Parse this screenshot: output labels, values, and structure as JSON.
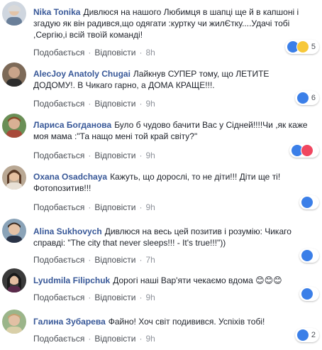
{
  "actions": {
    "like": "Подобається",
    "reply": "Відповісти",
    "sep": "·"
  },
  "colors": {
    "author": "#385898",
    "like": "#3b7fe8",
    "haha": "#f7c83a",
    "love": "#f0465f"
  },
  "comments": [
    {
      "author": "Nika Tonika",
      "text": "Дивлюся на нашого Любимця в шапці ще й в капшоні і згадую як він радився,що одягати :куртку чи жилЄтку....Удачі тобі ,Сергію,і всій твоїй команді!",
      "time": "8h",
      "reactions": [
        "like",
        "haha"
      ],
      "count": "5"
    },
    {
      "author": "AlecJoy Anatoly Chugai",
      "text": "Лайкнув СУПЕР тому, що ЛЕТИТЕ ДОДОМУ!. В Чикаго гарно, а ДОМА КРАЩЕ!!!.",
      "time": "9h",
      "reactions": [
        "like"
      ],
      "count": "6"
    },
    {
      "author": "Лариса Богданова",
      "text": "Було б чудово бачити Вас у Сідней!!!!Чи ,як каже моя мама :\"Та нащо мені той край світу?\"",
      "time": "9h",
      "reactions": [
        "like",
        "love"
      ],
      "count": ""
    },
    {
      "author": "Oxana Osadchaya",
      "text": "Кажуть, що дорослі, то не діти!!! Діти ще ті! Фотопозитив!!!",
      "time": "9h",
      "reactions": [
        "like"
      ],
      "count": ""
    },
    {
      "author": "Alina Sukhovych",
      "text": "Дивлюся на весь цей позитив і розумію: Чикаго справді: \"The city that never sleeps!!! - It's true!!!\"))",
      "time": "7h",
      "reactions": [
        "like"
      ],
      "count": ""
    },
    {
      "author": "Lyudmila Filipchuk",
      "text": "Дорогі наші Вар'яти чекаємо вдома 😊😊😊",
      "time": "9h",
      "reactions": [
        "like"
      ],
      "count": ""
    },
    {
      "author": "Галина Зубарева",
      "text": "Файно! Хоч світ подивився. Успіхів тобі!",
      "time": "9h",
      "reactions": [
        "like"
      ],
      "count": "2"
    }
  ]
}
